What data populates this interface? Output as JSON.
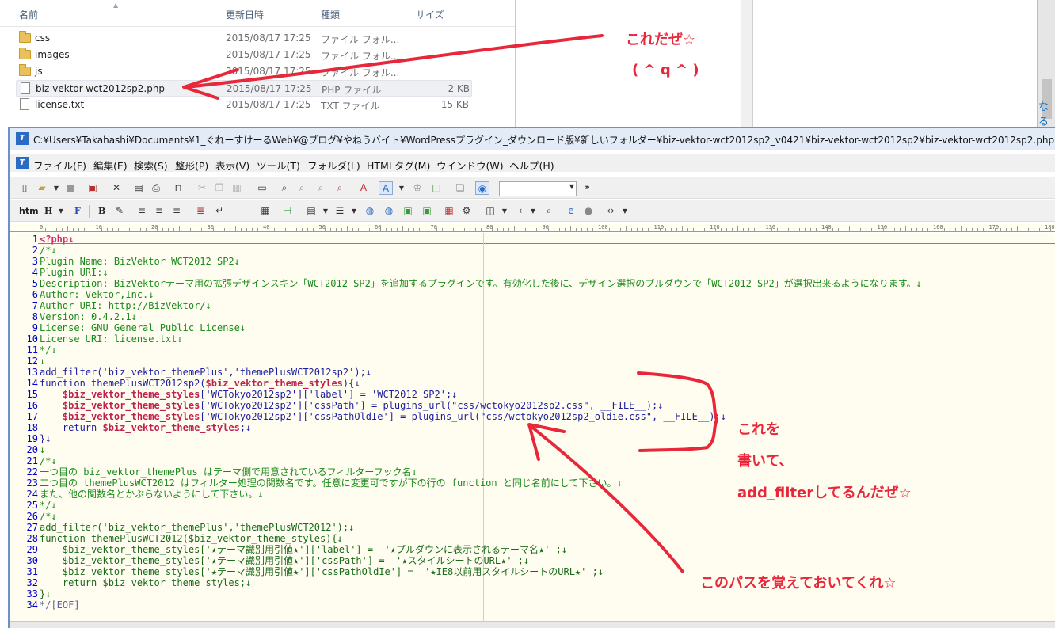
{
  "explorer": {
    "columns": [
      "名前",
      "更新日時",
      "種類",
      "サイズ"
    ],
    "files": [
      {
        "name": "css",
        "date": "2015/08/17 17:25",
        "type": "ファイル フォル...",
        "size": "",
        "icon": "folder-icon"
      },
      {
        "name": "images",
        "date": "2015/08/17 17:25",
        "type": "ファイル フォル...",
        "size": "",
        "icon": "folder-icon"
      },
      {
        "name": "js",
        "date": "2015/08/17 17:25",
        "type": "ファイル フォル...",
        "size": "",
        "icon": "folder-icon"
      },
      {
        "name": "biz-vektor-wct2012sp2.php",
        "date": "2015/08/17 17:25",
        "type": "PHP ファイル",
        "size": "2 KB",
        "icon": "document-icon"
      },
      {
        "name": "license.txt",
        "date": "2015/08/17 17:25",
        "type": "TXT ファイル",
        "size": "15 KB",
        "icon": "document-icon"
      }
    ],
    "right_cut_text": "なる"
  },
  "annotations": {
    "top_line1": "これだぜ☆",
    "top_line2": "( ^ q ^ )",
    "middle_line1": "これを",
    "middle_line2": "書いて、",
    "middle_line3": "add_filterしてるんだぜ☆",
    "bottom_line": "このパスを覚えておいてくれ☆",
    "color": "#e8283a"
  },
  "editor": {
    "title": "C:¥Users¥Takahashi¥Documents¥1_ぐれーすけーるWeb¥@ブログ¥やねうバイト¥WordPressプラグイン_ダウンロード版¥新しいフォルダー¥biz-vektor-wct2012sp2_v0421¥biz-vektor-wct2012sp2¥biz-vektor-wct2012sp2.php",
    "menu": [
      "ファイル(F)",
      "編集(E)",
      "検索(S)",
      "整形(P)",
      "表示(V)",
      "ツール(T)",
      "フォルダ(L)",
      "HTMLタグ(M)",
      "ウインドウ(W)",
      "ヘルプ(H)"
    ],
    "toolbar2_text": [
      "htm",
      "H",
      "F",
      "B"
    ],
    "ruler_labels": [
      "0",
      "10",
      "20",
      "30",
      "40",
      "50",
      "60",
      "70",
      "80",
      "90",
      "100",
      "110",
      "120",
      "130",
      "140",
      "150",
      "160",
      "170",
      "180"
    ],
    "lines": [
      {
        "n": "1",
        "t": "<?php↓",
        "k": "k2"
      },
      {
        "n": "2",
        "t": "/*↓",
        "k": "k0"
      },
      {
        "n": "3",
        "t": "Plugin Name: BizVektor WCT2012 SP2↓",
        "k": "k0"
      },
      {
        "n": "4",
        "t": "Plugin URI:↓",
        "k": "k0"
      },
      {
        "n": "5",
        "t": "Description: BizVektorテーマ用の拡張デザインスキン「WCT2012 SP2」を追加するプラグインです。有効化した後に、デザイン選択のプルダウンで「WCT2012 SP2」が選択出来るようになります。↓",
        "k": "k0"
      },
      {
        "n": "6",
        "t": "Author: Vektor,Inc.↓",
        "k": "k0"
      },
      {
        "n": "7",
        "t": "Author URI: http://BizVektor/↓",
        "k": "k0"
      },
      {
        "n": "8",
        "t": "Version: 0.4.2.1↓",
        "k": "k0"
      },
      {
        "n": "9",
        "t": "License: GNU General Public License↓",
        "k": "k0"
      },
      {
        "n": "10",
        "t": "License URI: license.txt↓",
        "k": "k0"
      },
      {
        "n": "11",
        "t": "*/↓",
        "k": "k0"
      },
      {
        "n": "12",
        "t": "↓",
        "k": "k0"
      },
      {
        "n": "13",
        "t": "add_filter('biz_vektor_themePlus','themePlusWCT2012sp2');↓",
        "k": "k1"
      },
      {
        "n": "14",
        "t": "function themePlusWCT2012sp2($biz_vektor_theme_styles){↓",
        "k": "k1"
      },
      {
        "n": "15",
        "t": "    $biz_vektor_theme_styles['WCTokyo2012sp2']['label'] = 'WCT2012 SP2';↓",
        "k": "k1"
      },
      {
        "n": "16",
        "t": "    $biz_vektor_theme_styles['WCTokyo2012sp2']['cssPath'] = plugins_url(\"css/wctokyo2012sp2.css\", __FILE__);↓",
        "k": "k1"
      },
      {
        "n": "17",
        "t": "    $biz_vektor_theme_styles['WCTokyo2012sp2']['cssPathOldIe'] = plugins_url(\"css/wctokyo2012sp2_oldie.css\", __FILE__);↓",
        "k": "k1"
      },
      {
        "n": "18",
        "t": "    return $biz_vektor_theme_styles;↓",
        "k": "k1"
      },
      {
        "n": "19",
        "t": "}↓",
        "k": "k1"
      },
      {
        "n": "20",
        "t": "↓",
        "k": "k0"
      },
      {
        "n": "21",
        "t": "/*↓",
        "k": "k0"
      },
      {
        "n": "22",
        "t": "一つ目の biz_vektor_themePlus はテーマ側で用意されているフィルターフック名↓",
        "k": "k0"
      },
      {
        "n": "23",
        "t": "二つ目の themePlusWCT2012 はフィルター処理の関数名です。任意に変更可ですが下の行の function と同じ名前にして下さい。↓",
        "k": "k0"
      },
      {
        "n": "24",
        "t": "また、他の関数名とかぶらないようにして下さい。↓",
        "k": "k0"
      },
      {
        "n": "25",
        "t": "*/↓",
        "k": "k0"
      },
      {
        "n": "26",
        "t": "/*↓",
        "k": "k0"
      },
      {
        "n": "27",
        "t": "add_filter('biz_vektor_themePlus','themePlusWCT2012');↓",
        "k": "k3"
      },
      {
        "n": "28",
        "t": "function themePlusWCT2012($biz_vektor_theme_styles){↓",
        "k": "k3"
      },
      {
        "n": "29",
        "t": "    $biz_vektor_theme_styles['★テーマ識別用引値★']['label'] =  '★プルダウンに表示されるテーマ名★' ;↓",
        "k": "k3"
      },
      {
        "n": "30",
        "t": "    $biz_vektor_theme_styles['★テーマ識別用引値★']['cssPath'] =  '★スタイルシートのURL★' ;↓",
        "k": "k3"
      },
      {
        "n": "31",
        "t": "    $biz_vektor_theme_styles['★テーマ識別用引値★']['cssPathOldIe'] =  '★IE8以前用スタイルシートのURL★' ;↓",
        "k": "k3"
      },
      {
        "n": "32",
        "t": "    return $biz_vektor_theme_styles;↓",
        "k": "k3"
      },
      {
        "n": "33",
        "t": "}↓",
        "k": "k3"
      },
      {
        "n": "34",
        "t": "*/[EOF]",
        "k": "k4"
      }
    ]
  }
}
